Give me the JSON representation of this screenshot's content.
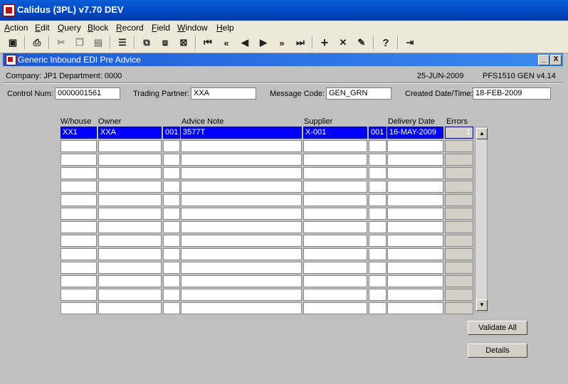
{
  "app": {
    "title": "Calidus (3PL) v7.70 DEV"
  },
  "menu": [
    "Action",
    "Edit",
    "Query",
    "Block",
    "Record",
    "Field",
    "Window",
    "Help"
  ],
  "toolbar_icons": [
    "save-icon",
    "print-icon",
    "cut-icon",
    "copy-icon",
    "paste-icon",
    "list-icon",
    "query-enter-icon",
    "query-execute-icon",
    "query-cancel-icon",
    "first-record-icon",
    "previous-block-icon",
    "previous-record-icon",
    "next-record-icon",
    "next-block-icon",
    "last-record-icon",
    "insert-record-icon",
    "delete-record-icon",
    "clear-record-icon",
    "help-icon",
    "exit-icon"
  ],
  "window": {
    "title": "Generic Inbound EDI Pre Advice",
    "minimize": "_",
    "close": "X"
  },
  "info": {
    "company": "Company:  JP1    Department:  0000",
    "date": "25-JUN-2009",
    "program": "PFS1510  GEN  v4.14"
  },
  "header_fields": {
    "control_num_label": "Control Num:",
    "control_num": "0000001561",
    "trading_partner_label": "Trading Partner:",
    "trading_partner": "XXA",
    "message_code_label": "Message Code:",
    "message_code": "GEN_GRN",
    "created_label": "Created Date/Time:",
    "created": "18-FEB-2009"
  },
  "grid": {
    "columns": [
      "W/house",
      "Owner",
      "Advice Note",
      "Supplier",
      "Delivery Date",
      "Errors"
    ],
    "rows": [
      [
        "XX1",
        "XXA",
        "001",
        "3577T",
        "X-001",
        "001",
        "16-MAY-2009",
        "1"
      ],
      [
        "",
        "",
        "",
        "",
        "",
        "",
        "",
        ""
      ],
      [
        "",
        "",
        "",
        "",
        "",
        "",
        "",
        ""
      ],
      [
        "",
        "",
        "",
        "",
        "",
        "",
        "",
        ""
      ],
      [
        "",
        "",
        "",
        "",
        "",
        "",
        "",
        ""
      ],
      [
        "",
        "",
        "",
        "",
        "",
        "",
        "",
        ""
      ],
      [
        "",
        "",
        "",
        "",
        "",
        "",
        "",
        ""
      ],
      [
        "",
        "",
        "",
        "",
        "",
        "",
        "",
        ""
      ],
      [
        "",
        "",
        "",
        "",
        "",
        "",
        "",
        ""
      ],
      [
        "",
        "",
        "",
        "",
        "",
        "",
        "",
        ""
      ],
      [
        "",
        "",
        "",
        "",
        "",
        "",
        "",
        ""
      ],
      [
        "",
        "",
        "",
        "",
        "",
        "",
        "",
        ""
      ],
      [
        "",
        "",
        "",
        "",
        "",
        "",
        "",
        ""
      ],
      [
        "",
        "",
        "",
        "",
        "",
        "",
        "",
        ""
      ]
    ]
  },
  "buttons": {
    "validate_all": "Validate All",
    "details": "Details"
  }
}
